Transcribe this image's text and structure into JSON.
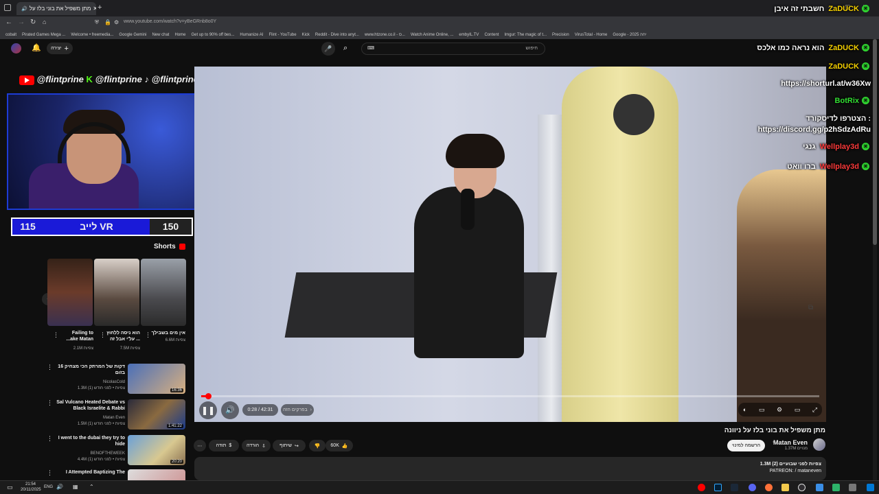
{
  "browser": {
    "tab_title": "מתן משפיל את בוני בלז על ",
    "url": "www.youtube.com/watch?v=yBeGRnb8o0Y",
    "bookmarks": [
      "cobalt",
      "Pirated Games Mega ...",
      "Welcome • freemedia...",
      "Google Gemini",
      "New chat",
      "Home",
      "Get up to 90% off bes...",
      "Humanize AI",
      "Flint - YouTube",
      "Kick",
      "Reddit - Dive into anyt...",
      "www.htzone.co.il - ס...",
      "Watch Anime Online, ...",
      "embyIL.TV",
      "Content",
      "Imgur: The magic of t...",
      "Precision",
      "VirusTotal - Home",
      "Google - 2025 יחה"
    ]
  },
  "ytbar": {
    "create_label": "יצירה",
    "search_placeholder": "חיפוש"
  },
  "overlay": {
    "handle_yt": "@flintprine",
    "handle_kick": "@flintprine",
    "handle_tiktok": "@flintprine",
    "vr_left": "115",
    "vr_label": "לייב VR",
    "vr_right": "150"
  },
  "chat": [
    {
      "user": "ZaDUCK",
      "text": "חשבתי זה איבן",
      "color": "#f5d000"
    },
    {
      "user": "ZaDUCK",
      "text": "הוא נראה כמו אלכס",
      "color": "#f5d000"
    },
    {
      "user": "ZaDUCK",
      "text": "",
      "color": "#f5d000"
    },
    {
      "user": "",
      "text": "https://shorturl.at/w36Xw",
      "color": "#ffffff"
    },
    {
      "user": "BotRix",
      "text": "",
      "color": "#33e033"
    },
    {
      "user": "",
      "text": "הצטרפו לדיסקורד :",
      "color": "#ffffff"
    },
    {
      "user": "",
      "text": "https://discord.gg/p2hSdzAdRu",
      "color": "#ffffff"
    },
    {
      "user": "Wellplay3d",
      "text": "גנגי",
      "color": "#ff3b3b"
    },
    {
      "user": "Wellplay3d",
      "text": "ברו וואט",
      "color": "#ff3b3b"
    }
  ],
  "shorts": {
    "heading": "Shorts",
    "items": [
      {
        "title": "Failing to ...ake Matan",
        "views": "2.1M צפיות"
      },
      {
        "title": "הוא ניסה ללחוץ על'י אבל זה ...",
        "views": "7.5M צפיות"
      },
      {
        "title": "אין מים בשבילך",
        "views": "6.6M צפיות"
      }
    ]
  },
  "recommended": [
    {
      "title": "16 דקות של המרתק הכי מצחיק בזום",
      "channel": "NicolasCold",
      "meta": "1.3M צפיות • לפני חודש (1)",
      "duration": "16:36"
    },
    {
      "title": "Sal Vulcano Heated Debate vs Black Israelite & Rabbi",
      "channel": "Matan Even",
      "meta": "1.5M צפיות • לפני חודש (1)",
      "duration": "1:41:22"
    },
    {
      "title": "I went to the dubai they try to hide",
      "channel": "BENOFTHEWEEK",
      "meta": "4.4M צפיות • לפני חודש (1)",
      "duration": "20:20"
    },
    {
      "title": "I Attempted Baptizing The",
      "channel": "",
      "meta": "",
      "duration": ""
    }
  ],
  "player": {
    "time": "0:28 / 42:31",
    "chapter": "בפרקים הזה",
    "progress": 0.011
  },
  "video_info": {
    "title": "מתן משפיל את בוני בלז על ניוונה",
    "channel": "Matan Even",
    "subs": "1.37M מנויים",
    "join_label": "הרשמה למינוי",
    "likes": "60K",
    "share_label": "שיתוף",
    "download_label": "הורדה",
    "thanks_label": "תודה",
    "views_line": "1.3M צפיות  לפני שבועיים (2)",
    "patreon_line": "PATREON: / mataneven"
  },
  "taskbar": {
    "time": "21:54",
    "date": "20/11/2025",
    "lang": "ENG"
  }
}
